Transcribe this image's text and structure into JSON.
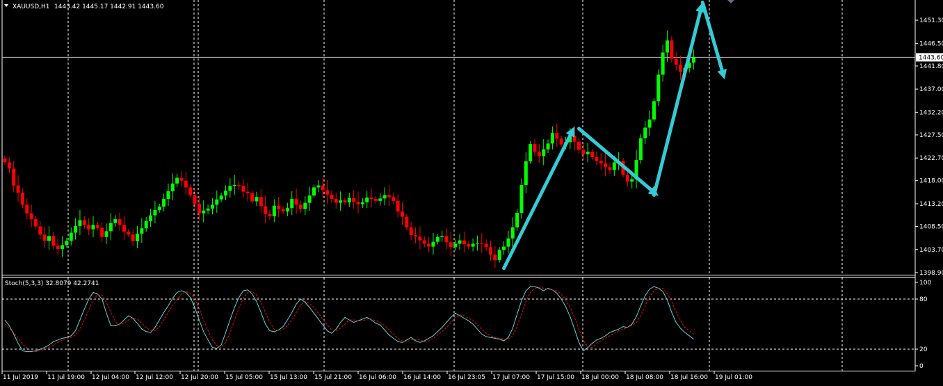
{
  "header": {
    "symbol": "XAUUSD,H1",
    "ohlc": "1443.42 1445.17 1442.91 1443.60"
  },
  "price_panel": {
    "y_ticks": [
      "1451.30",
      "1446.50",
      "1441.80",
      "1437.00",
      "1432.20",
      "1427.50",
      "1422.70",
      "1418.00",
      "1413.20",
      "1408.50",
      "1403.70",
      "1398.90"
    ],
    "ylim": [
      1398.9,
      1455.5
    ],
    "current_price": "1443.60"
  },
  "stoch_panel": {
    "label": "Stoch(5,3,3) 32.8079 42.2741",
    "y_ticks": [
      "100",
      "80",
      "20",
      "0"
    ],
    "levels": [
      80,
      20
    ],
    "ylim": [
      0,
      100
    ]
  },
  "x_ticks": [
    "11 Jul 2019",
    "11 Jul 19:00",
    "12 Jul 04:00",
    "12 Jul 12:00",
    "12 Jul 20:00",
    "15 Jul 05:00",
    "15 Jul 13:00",
    "15 Jul 21:00",
    "16 Jul 06:00",
    "16 Jul 14:00",
    "16 Jul 23:05",
    "17 Jul 07:00",
    "17 Jul 15:00",
    "18 Jul 00:00",
    "18 Jul 08:00",
    "18 Jul 16:00",
    "19 Jul 01:00"
  ],
  "colors": {
    "background": "#000000",
    "bull": "#00ff00",
    "bear": "#ff0000",
    "main_line": "#5fd7e0",
    "signal_line": "#ff0000",
    "arrow": "#33ccd6",
    "grid": "#ffffff",
    "text": "#ffffff"
  },
  "chart_data": {
    "type": "candlestick",
    "title": "XAUUSD,H1",
    "x_labels": [
      "11 Jul 2019",
      "11 Jul 19:00",
      "12 Jul 04:00",
      "12 Jul 12:00",
      "12 Jul 20:00",
      "15 Jul 05:00",
      "15 Jul 13:00",
      "15 Jul 21:00",
      "16 Jul 06:00",
      "16 Jul 14:00",
      "16 Jul 23:05",
      "17 Jul 07:00",
      "17 Jul 15:00",
      "18 Jul 00:00",
      "18 Jul 08:00",
      "18 Jul 16:00",
      "19 Jul 01:00"
    ],
    "price_close_approx": [
      1421.8,
      1420.5,
      1417.0,
      1415.5,
      1413.0,
      1411.2,
      1410.0,
      1408.5,
      1406.8,
      1405.5,
      1406.5,
      1404.5,
      1403.8,
      1404.6,
      1405.5,
      1407.2,
      1408.6,
      1409.8,
      1408.8,
      1407.9,
      1408.8,
      1408.2,
      1406.3,
      1407.5,
      1409.2,
      1410.0,
      1408.8,
      1407.4,
      1406.8,
      1405.4,
      1407.0,
      1408.1,
      1409.6,
      1410.8,
      1411.9,
      1412.6,
      1414.2,
      1415.8,
      1417.4,
      1418.6,
      1418.0,
      1416.6,
      1415.0,
      1413.2,
      1411.2,
      1411.8,
      1412.2,
      1413.0,
      1414.1,
      1414.9,
      1415.9,
      1416.9,
      1417.1,
      1416.9,
      1415.7,
      1415.4,
      1413.7,
      1414.6,
      1412.7,
      1411.1,
      1410.6,
      1412.8,
      1412.1,
      1411.6,
      1412.3,
      1414.2,
      1413.0,
      1412.1,
      1413.4,
      1414.9,
      1416.6,
      1417.0,
      1416.0,
      1415.1,
      1414.2,
      1413.4,
      1413.9,
      1413.5,
      1414.4,
      1413.6,
      1413.1,
      1413.5,
      1414.5,
      1414.2,
      1413.8,
      1414.3,
      1415.0,
      1414.6,
      1413.8,
      1411.6,
      1410.5,
      1408.3,
      1406.7,
      1406.4,
      1405.6,
      1404.9,
      1404.3,
      1405.3,
      1406.3,
      1406.5,
      1405.2,
      1404.2,
      1404.9,
      1405.6,
      1404.8,
      1404.3,
      1404.9,
      1405.0,
      1404.9,
      1404.2,
      1402.6,
      1401.5,
      1403.6,
      1404.3,
      1406.0,
      1408.3,
      1411.3,
      1417.1,
      1422.0,
      1425.6,
      1424.0,
      1423.1,
      1424.5,
      1425.7,
      1427.9,
      1426.7,
      1425.5,
      1426.0,
      1427.3,
      1426.1,
      1424.4,
      1423.5,
      1424.0,
      1422.9,
      1422.1,
      1421.6,
      1420.8,
      1420.2,
      1421.8,
      1422.1,
      1419.2,
      1417.8,
      1418.3,
      1422.3,
      1426.8,
      1429.0,
      1430.7,
      1434.5,
      1440.0,
      1444.6,
      1447.1,
      1443.3,
      1442.1,
      1440.6,
      1441.4,
      1442.5,
      1443.6
    ],
    "stoch_main": [
      55,
      48,
      38,
      27,
      18,
      17,
      17,
      18,
      20,
      22,
      25,
      29,
      31,
      33,
      34,
      36,
      42,
      55,
      68,
      80,
      88,
      86,
      80,
      63,
      48,
      48,
      50,
      55,
      60,
      57,
      51,
      44,
      41,
      40,
      46,
      55,
      64,
      72,
      81,
      88,
      90,
      88,
      82,
      70,
      55,
      41,
      31,
      22,
      21,
      25,
      40,
      55,
      70,
      82,
      90,
      91,
      86,
      77,
      64,
      50,
      42,
      41,
      43,
      47,
      55,
      64,
      74,
      80,
      76,
      70,
      63,
      56,
      49,
      42,
      39,
      44,
      52,
      58,
      55,
      52,
      54,
      56,
      58,
      55,
      51,
      49,
      43,
      37,
      33,
      29,
      28,
      31,
      34,
      30,
      28,
      30,
      33,
      36,
      41,
      46,
      52,
      58,
      63,
      60,
      57,
      54,
      50,
      44,
      38,
      35,
      34,
      33,
      32,
      30,
      34,
      45,
      62,
      78,
      90,
      95,
      95,
      93,
      90,
      93,
      91,
      87,
      80,
      71,
      59,
      44,
      28,
      18,
      22,
      27,
      31,
      33,
      36,
      40,
      42,
      44,
      47,
      46,
      50,
      59,
      72,
      84,
      92,
      95,
      93,
      89,
      79,
      64,
      52,
      45,
      40,
      36,
      32
    ],
    "stoch_signal": [
      50,
      45,
      40,
      33,
      26,
      21,
      18,
      17,
      18,
      20,
      22,
      25,
      28,
      31,
      33,
      34,
      37,
      44,
      55,
      67,
      79,
      85,
      85,
      76,
      64,
      53,
      49,
      51,
      55,
      57,
      56,
      51,
      46,
      42,
      42,
      47,
      55,
      64,
      72,
      80,
      86,
      89,
      87,
      80,
      69,
      55,
      42,
      31,
      24,
      22,
      28,
      40,
      55,
      69,
      81,
      88,
      89,
      85,
      76,
      64,
      52,
      44,
      42,
      44,
      48,
      55,
      64,
      73,
      77,
      75,
      70,
      63,
      56,
      49,
      43,
      42,
      45,
      50,
      55,
      55,
      54,
      54,
      56,
      56,
      54,
      52,
      48,
      43,
      38,
      33,
      30,
      29,
      31,
      32,
      31,
      29,
      30,
      33,
      37,
      41,
      46,
      52,
      58,
      61,
      60,
      57,
      54,
      49,
      44,
      39,
      36,
      34,
      33,
      32,
      32,
      36,
      47,
      62,
      77,
      88,
      93,
      94,
      93,
      92,
      91,
      90,
      86,
      79,
      70,
      58,
      44,
      30,
      23,
      22,
      27,
      30,
      33,
      36,
      39,
      42,
      44,
      46,
      48,
      52,
      60,
      72,
      83,
      90,
      93,
      93,
      87,
      77,
      65,
      54,
      46,
      42,
      38
    ],
    "stoch_ylim": [
      0,
      100
    ]
  }
}
